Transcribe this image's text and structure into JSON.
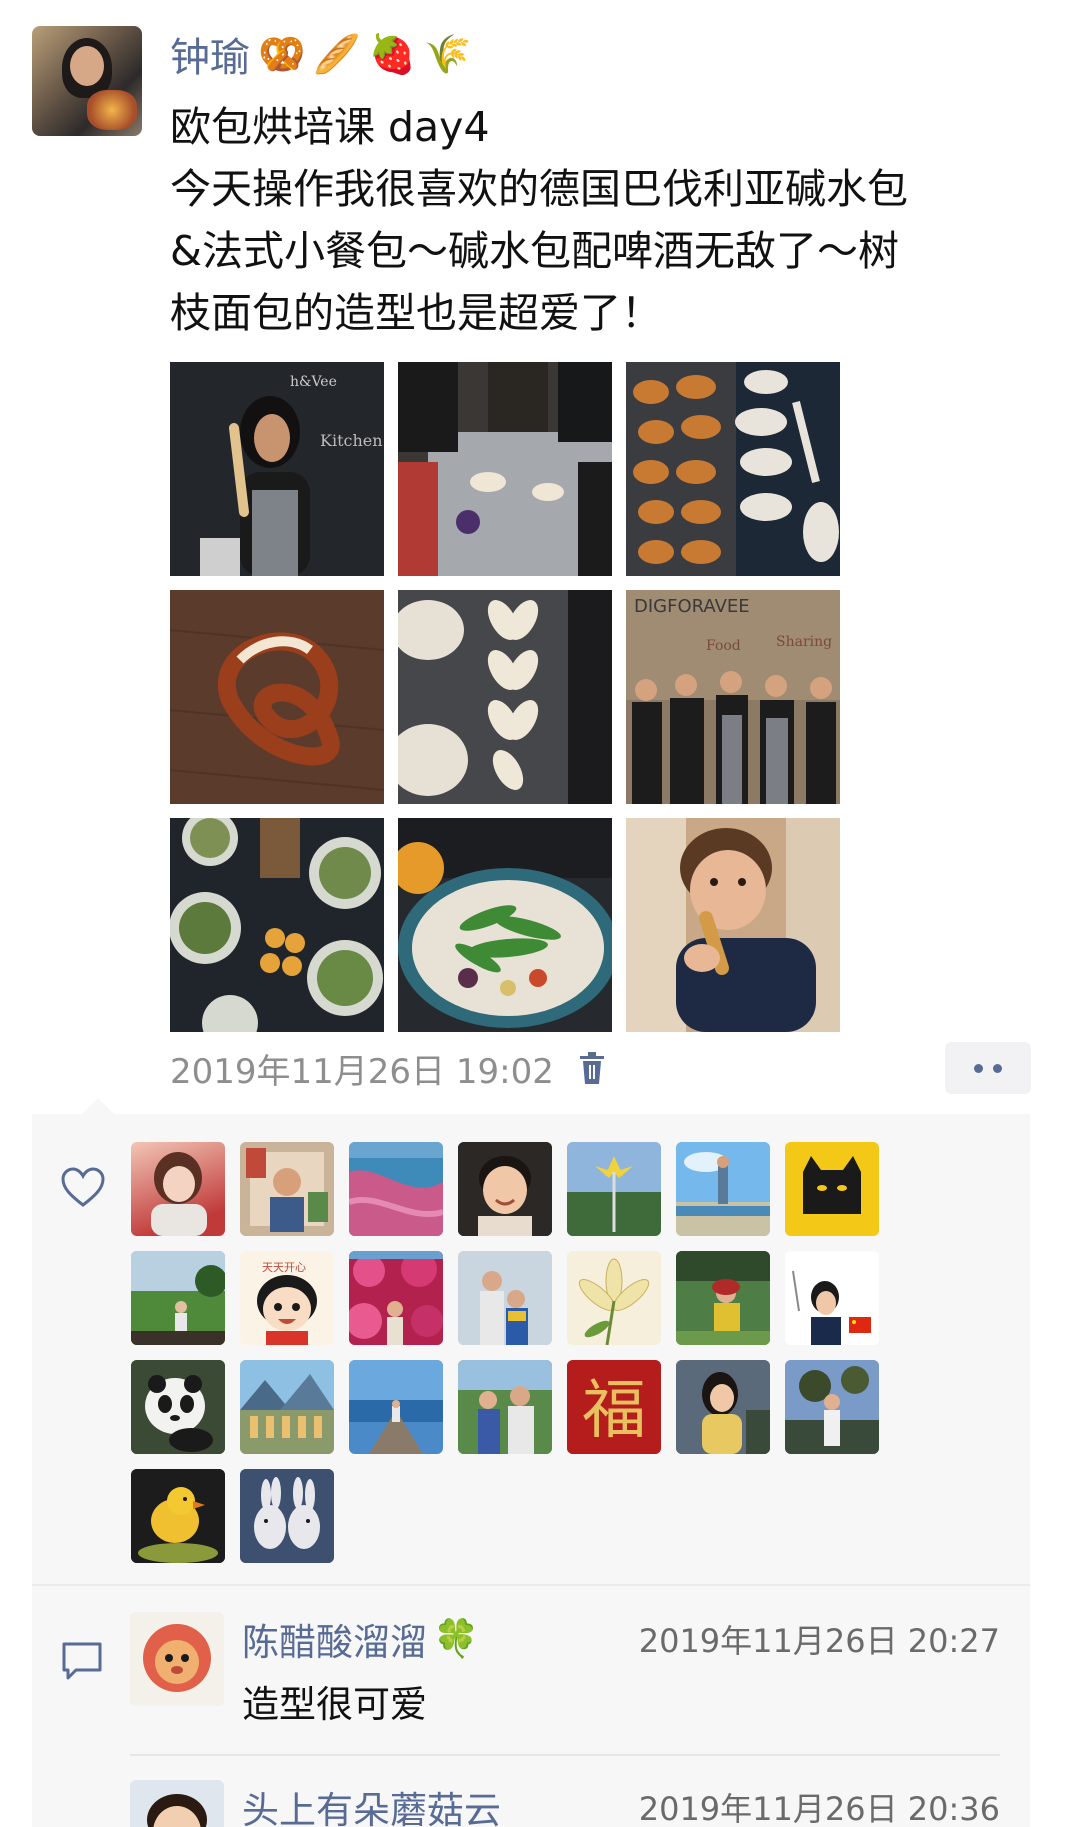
{
  "post": {
    "author": "钟瑜",
    "author_emojis": [
      "🥨",
      "🥖",
      "🍓",
      "🌾"
    ],
    "text_lines": [
      "欧包烘培课 day4",
      "今天操作我很喜欢的德国巴伐利亚碱水包",
      "&法式小餐包～碱水包配啤酒无敌了～树",
      "枝面包的造型也是超爱了！"
    ],
    "timestamp": "2019年11月26日 19:02"
  },
  "photos": [
    {
      "name": "photo-woman-with-bread",
      "icon": "photo"
    },
    {
      "name": "photo-kneading-dough",
      "icon": "photo"
    },
    {
      "name": "photo-pretzel-tray",
      "icon": "photo"
    },
    {
      "name": "photo-pretzel-closeup",
      "icon": "photo"
    },
    {
      "name": "photo-branch-bread",
      "icon": "photo"
    },
    {
      "name": "photo-group",
      "icon": "photo"
    },
    {
      "name": "photo-dishes",
      "icon": "photo"
    },
    {
      "name": "photo-salad-plate",
      "icon": "photo"
    },
    {
      "name": "photo-child-eating",
      "icon": "photo"
    }
  ],
  "likes": {
    "icon": "heart-outline-icon",
    "avatars": [
      "liker-1",
      "liker-2",
      "liker-3",
      "liker-4",
      "liker-5",
      "liker-6",
      "liker-7",
      "liker-8",
      "liker-9",
      "liker-10",
      "liker-11",
      "liker-12",
      "liker-13",
      "liker-14",
      "liker-15",
      "liker-16",
      "liker-17",
      "liker-18",
      "liker-19",
      "liker-20",
      "liker-21",
      "liker-22",
      "liker-23"
    ],
    "fu_char": "福",
    "badge_text": "天天开心"
  },
  "comments": [
    {
      "name": "陈醋酸溜溜",
      "name_emoji": "🍀",
      "time": "2019年11月26日 20:27",
      "text": "造型很可爱"
    },
    {
      "name": "头上有朵蘑菇云",
      "name_emoji": "",
      "time": "2019年11月26日 20:36",
      "text": ""
    }
  ],
  "colors": {
    "link": "#576b95",
    "meta": "#8e8e8e",
    "panel": "#f7f7f7"
  }
}
